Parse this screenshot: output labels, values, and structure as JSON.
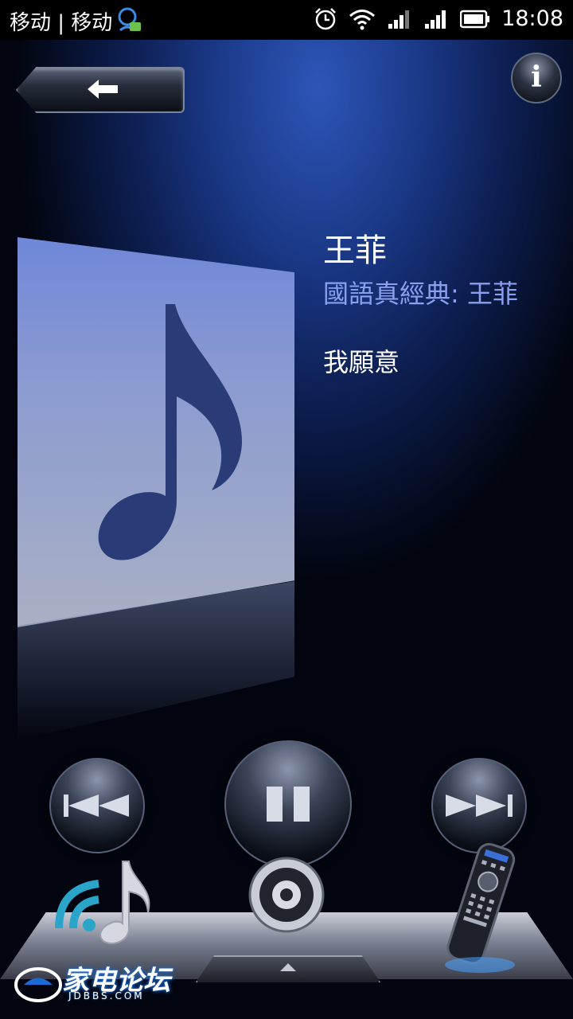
{
  "status_bar": {
    "carrier": "移动 | 移动",
    "time": "18:08"
  },
  "header": {
    "back_icon": "arrow-left-icon",
    "info_label": "i"
  },
  "now_playing": {
    "artist": "王菲",
    "album": "國語真經典: 王菲",
    "song": "我願意",
    "album_art_icon": "music-note-icon"
  },
  "controls": {
    "prev_icon": "skip-previous-icon",
    "pause_icon": "pause-icon",
    "next_icon": "skip-next-icon"
  },
  "dock": {
    "items": [
      {
        "icon": "wireless-music-icon"
      },
      {
        "icon": "speaker-icon"
      },
      {
        "icon": "remote-control-icon"
      }
    ]
  },
  "watermark": {
    "text": "家电论坛",
    "sub": "JDBBS.COM"
  },
  "colors": {
    "background_glow": "#2d56b8",
    "album_text": "#8aa0ee"
  }
}
